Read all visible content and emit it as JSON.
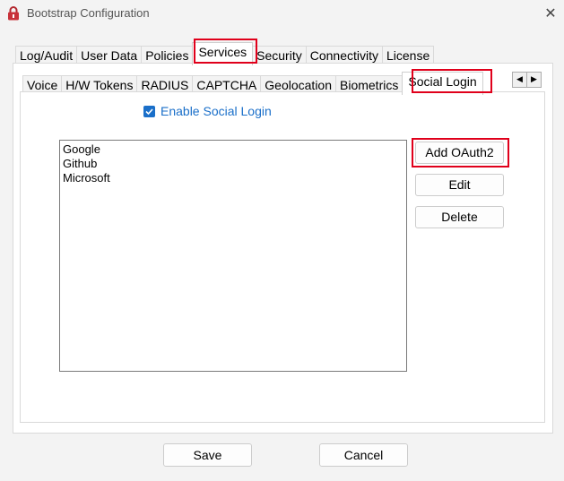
{
  "window": {
    "title": "Bootstrap Configuration",
    "close_glyph": "✕",
    "icon": "lock-icon"
  },
  "outer_tabs": [
    {
      "label": "Log/Audit",
      "selected": false
    },
    {
      "label": "User Data",
      "selected": false
    },
    {
      "label": "Policies",
      "selected": false
    },
    {
      "label": "Services",
      "selected": true
    },
    {
      "label": "Security",
      "selected": false
    },
    {
      "label": "Connectivity",
      "selected": false
    },
    {
      "label": "License",
      "selected": false
    }
  ],
  "inner_tabs": [
    {
      "label": "Voice",
      "selected": false
    },
    {
      "label": "H/W Tokens",
      "selected": false
    },
    {
      "label": "RADIUS",
      "selected": false
    },
    {
      "label": "CAPTCHA",
      "selected": false
    },
    {
      "label": "Geolocation",
      "selected": false
    },
    {
      "label": "Biometrics",
      "selected": false
    },
    {
      "label": "Social Login",
      "selected": true
    }
  ],
  "tab_scroll": {
    "left": "◀",
    "right": "▶"
  },
  "social_login": {
    "enable_label": "Enable Social Login",
    "enabled": true,
    "providers": [
      "Google",
      "Github",
      "Microsoft"
    ],
    "add_label": "Add OAuth2",
    "edit_label": "Edit",
    "delete_label": "Delete"
  },
  "footer": {
    "save_label": "Save",
    "cancel_label": "Cancel"
  },
  "colors": {
    "highlight": "#e0001b",
    "accent": "#1a6fc9"
  }
}
